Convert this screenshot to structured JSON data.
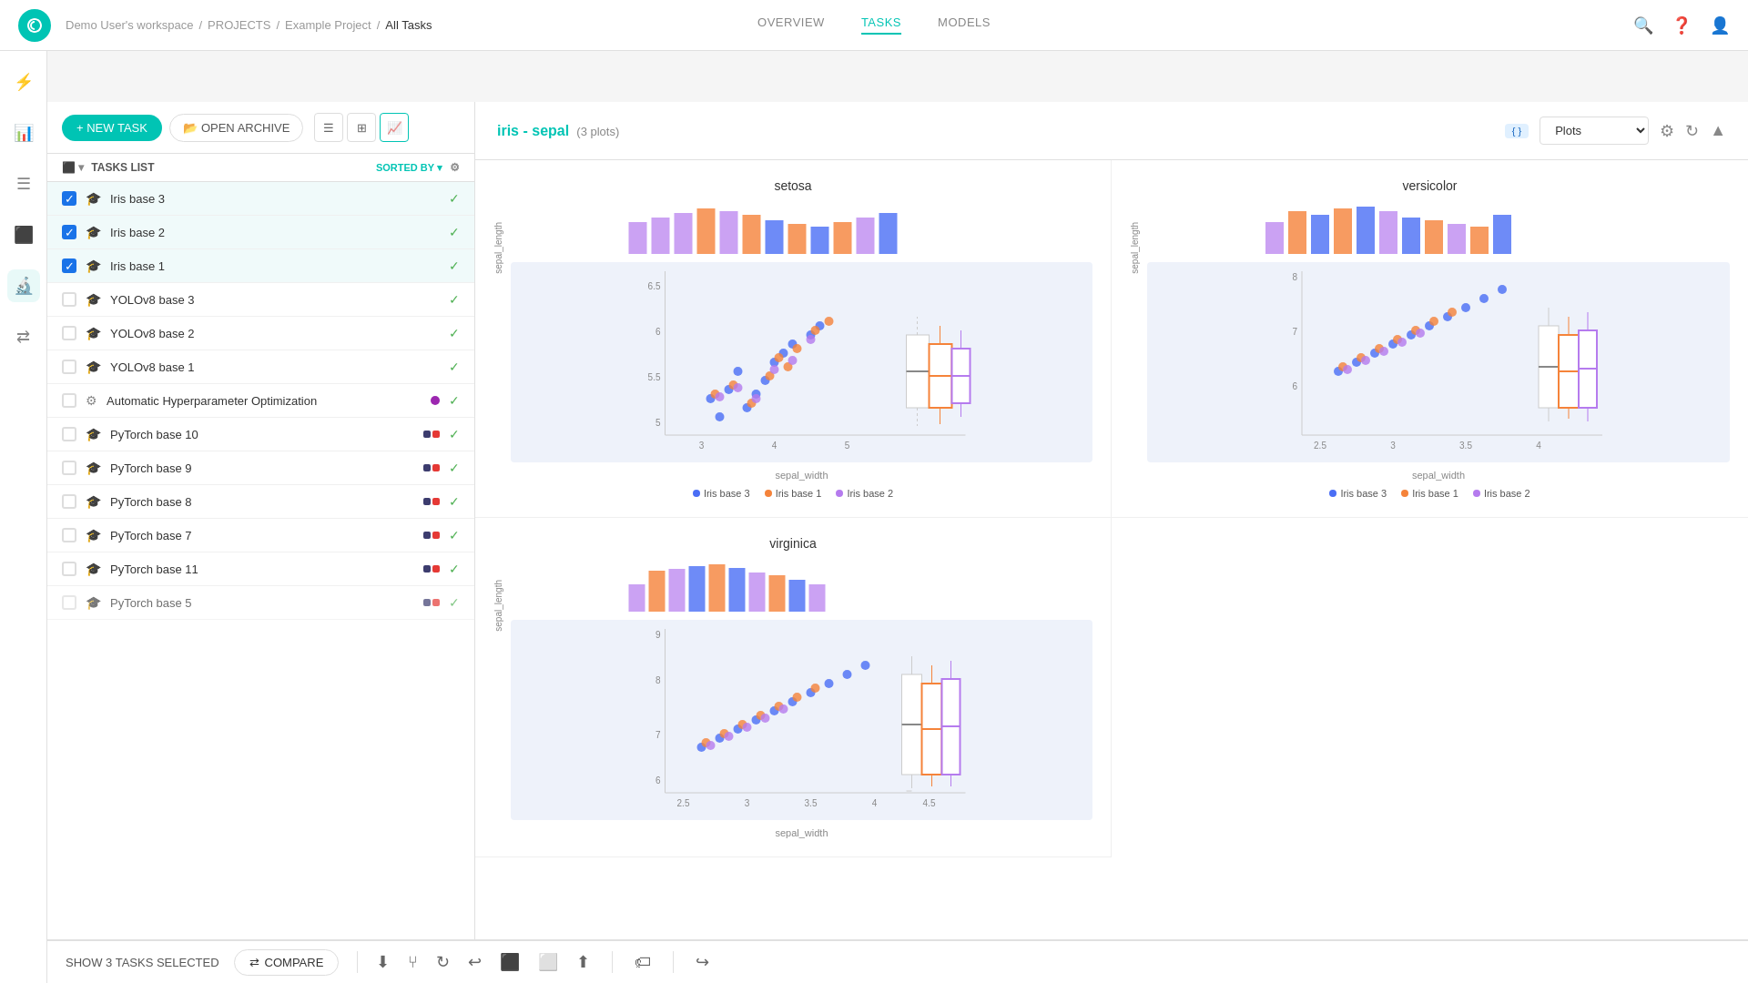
{
  "app": {
    "logo": "C",
    "breadcrumb": [
      "Demo User's workspace",
      "PROJECTS",
      "Example Project",
      "All Tasks"
    ]
  },
  "nav": {
    "tabs": [
      {
        "label": "OVERVIEW",
        "active": false
      },
      {
        "label": "TASKS",
        "active": true
      },
      {
        "label": "MODELS",
        "active": false
      }
    ]
  },
  "toolbar": {
    "new_task": "+ NEW TASK",
    "open_archive": "OPEN ARCHIVE"
  },
  "tasks_list": {
    "header": "TASKS LIST",
    "sorted_by": "SORTED BY",
    "items": [
      {
        "name": "Iris base 3",
        "checked": true,
        "check_mark": true,
        "type": "experiment"
      },
      {
        "name": "Iris base 2",
        "checked": true,
        "check_mark": true,
        "type": "experiment"
      },
      {
        "name": "Iris base 1",
        "checked": true,
        "check_mark": true,
        "type": "experiment"
      },
      {
        "name": "YOLOv8 base 3",
        "checked": false,
        "check_mark": true,
        "type": "experiment"
      },
      {
        "name": "YOLOv8 base 2",
        "checked": false,
        "check_mark": true,
        "type": "experiment"
      },
      {
        "name": "YOLOv8 base 1",
        "checked": false,
        "check_mark": true,
        "type": "experiment"
      },
      {
        "name": "Automatic Hyperparameter Optimization",
        "checked": false,
        "check_mark": true,
        "type": "hpo",
        "badge": "purple"
      },
      {
        "name": "PyTorch base 10",
        "checked": false,
        "check_mark": true,
        "type": "experiment",
        "double_badge": true
      },
      {
        "name": "PyTorch base 9",
        "checked": false,
        "check_mark": true,
        "type": "experiment",
        "double_badge": true
      },
      {
        "name": "PyTorch base 8",
        "checked": false,
        "check_mark": true,
        "type": "experiment",
        "double_badge": true
      },
      {
        "name": "PyTorch base 7",
        "checked": false,
        "check_mark": true,
        "type": "experiment",
        "double_badge": true
      },
      {
        "name": "PyTorch base 11",
        "checked": false,
        "check_mark": true,
        "type": "experiment",
        "double_badge": true
      },
      {
        "name": "PyTorch base 5",
        "checked": false,
        "check_mark": true,
        "type": "experiment",
        "double_badge": true
      }
    ]
  },
  "plots_panel": {
    "title": "iris - sepal",
    "subtitle": "(3 plots)",
    "dropdown_value": "Plots",
    "plots": [
      {
        "title": "setosa",
        "x_label": "sepal_width",
        "y_label": "sepal_length",
        "x_range": "3 to 5",
        "y_range": "5 to 6.5"
      },
      {
        "title": "versicolor",
        "x_label": "sepal_width",
        "y_label": "sepal_length",
        "x_range": "2.5 to 4",
        "y_range": "6 to 8"
      },
      {
        "title": "virginica",
        "x_label": "sepal_width",
        "y_label": "sepal_length",
        "x_range": "2.5 to 4.5",
        "y_range": "6 to 9"
      }
    ],
    "legend": [
      {
        "label": "Iris base 3",
        "color": "#4a6ef5"
      },
      {
        "label": "Iris base 1",
        "color": "#f5833a"
      },
      {
        "label": "Iris base 2",
        "color": "#b57bee"
      }
    ]
  },
  "bottom_bar": {
    "selected_info": "SHOW 3 TASKS SELECTED",
    "compare_label": "COMPARE"
  },
  "colors": {
    "accent": "#00c4b4",
    "blue": "#4a6ef5",
    "orange": "#f5833a",
    "purple": "#b57bee"
  }
}
